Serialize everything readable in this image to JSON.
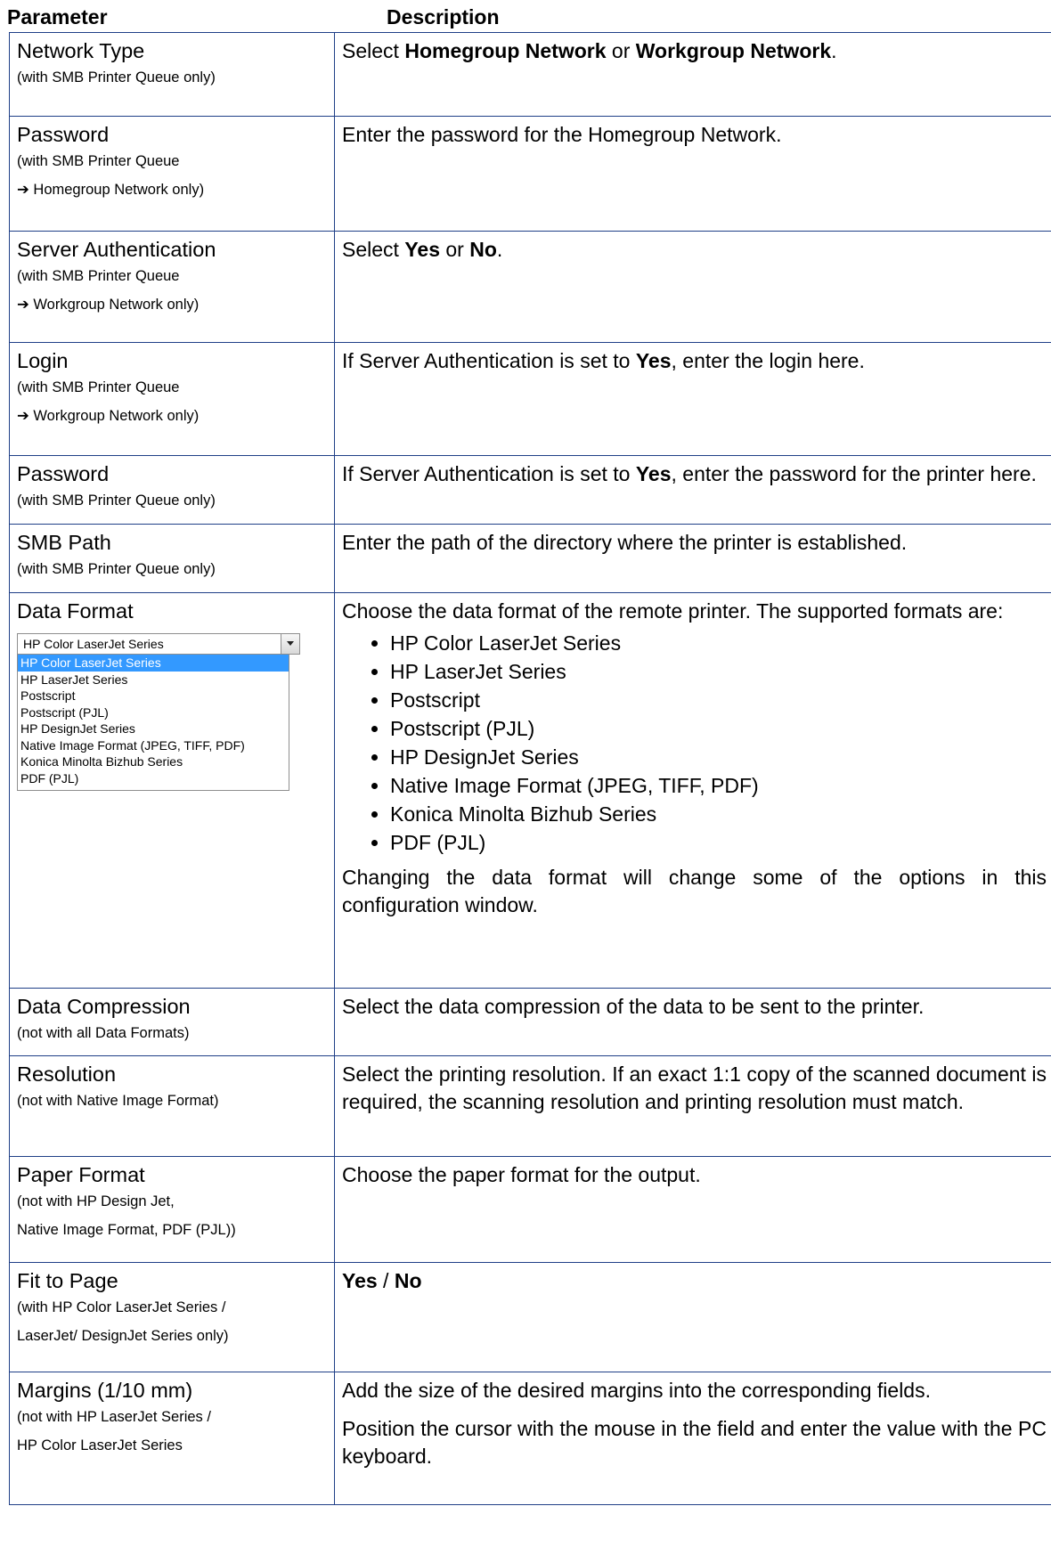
{
  "header": {
    "parameter": "Parameter",
    "description": "Description"
  },
  "rows": [
    {
      "name": "Network Type",
      "notes": [
        "(with SMB Printer Queue only)"
      ],
      "desc": [
        {
          "t": "Select "
        },
        {
          "b": "Homegroup Network"
        },
        {
          "t": " or "
        },
        {
          "b": "Workgroup Network"
        },
        {
          "t": "."
        }
      ]
    },
    {
      "name": "Password",
      "notes": [
        "(with SMB Printer Queue",
        "➔ Homegroup Network only)"
      ],
      "desc": [
        {
          "t": "Enter the password for the Homegroup Network."
        }
      ]
    },
    {
      "name": "Server Authentication",
      "notes": [
        "(with SMB Printer Queue",
        "➔ Workgroup Network only)"
      ],
      "desc": [
        {
          "t": "Select "
        },
        {
          "b": "Yes"
        },
        {
          "t": " or "
        },
        {
          "b": "No"
        },
        {
          "t": "."
        }
      ]
    },
    {
      "name": "Login",
      "notes": [
        "(with SMB Printer Queue",
        "➔ Workgroup Network only)"
      ],
      "desc": [
        {
          "t": "If Server Authentication is set to "
        },
        {
          "b": "Yes"
        },
        {
          "t": ", enter the login here."
        }
      ]
    },
    {
      "name": "Password",
      "notes": [
        "(with SMB Printer Queue only)"
      ],
      "desc": [
        {
          "t": "If Server Authentication is set to "
        },
        {
          "b": "Yes"
        },
        {
          "t": ", enter the password for the printer here."
        }
      ]
    },
    {
      "name": "SMB Path",
      "notes": [
        "(with SMB Printer Queue only)"
      ],
      "desc": [
        {
          "t": "Enter the path of the directory where the printer is established."
        }
      ]
    },
    {
      "name": "Data Format",
      "notes": [],
      "dropdown": true,
      "desc": [
        {
          "t": "Choose the data format of the remote printer. The supported formats are:"
        }
      ],
      "list": true,
      "desc_after": "Changing the data format will change some of the options in this configuration window."
    },
    {
      "name": "Data Compression",
      "notes": [
        "(not with all Data Formats)"
      ],
      "desc": [
        {
          "t": "Select the data compression of the data to be sent to the printer."
        }
      ]
    },
    {
      "name": "Resolution",
      "notes": [
        "(not with Native Image Format)"
      ],
      "desc": [
        {
          "t": "Select the printing resolution. If an exact 1:1 copy of the scanned document is required, the scanning resolution and printing resolution must match."
        }
      ]
    },
    {
      "name": "Paper Format",
      "notes": [
        "(not with HP Design Jet,",
        "Native Image Format, PDF (PJL))"
      ],
      "desc": [
        {
          "t": "Choose the paper format for the output."
        }
      ]
    },
    {
      "name": "Fit to Page",
      "notes": [
        "(with HP Color LaserJet Series /",
        "LaserJet/ DesignJet Series only)"
      ],
      "desc": [
        {
          "b": "Yes"
        },
        {
          "t": " / "
        },
        {
          "b": "No"
        }
      ]
    },
    {
      "name": "Margins (1/10 mm)",
      "notes": [
        "(not with HP LaserJet Series /",
        "HP Color LaserJet Series"
      ],
      "desc": [
        {
          "t": "Add the size of the desired margins into the corresponding fields."
        }
      ],
      "desc_after": "Position the cursor with the mouse in the field and enter the value with the PC keyboard."
    }
  ],
  "data_formats": [
    "HP Color LaserJet Series",
    "HP LaserJet Series",
    "Postscript",
    "Postscript (PJL)",
    "HP DesignJet Series",
    "Native Image Format (JPEG, TIFF, PDF)",
    "Konica Minolta Bizhub Series",
    "PDF (PJL)"
  ],
  "dropdown": {
    "selected": "HP Color LaserJet Series",
    "options": [
      "HP Color LaserJet Series",
      "HP LaserJet Series",
      "Postscript",
      "Postscript (PJL)",
      "HP DesignJet Series",
      "Native Image Format (JPEG, TIFF, PDF)",
      "Konica Minolta Bizhub Series",
      "PDF (PJL)"
    ],
    "highlight_color": "#3399ff"
  },
  "colors": {
    "border": "#1f3f87"
  }
}
